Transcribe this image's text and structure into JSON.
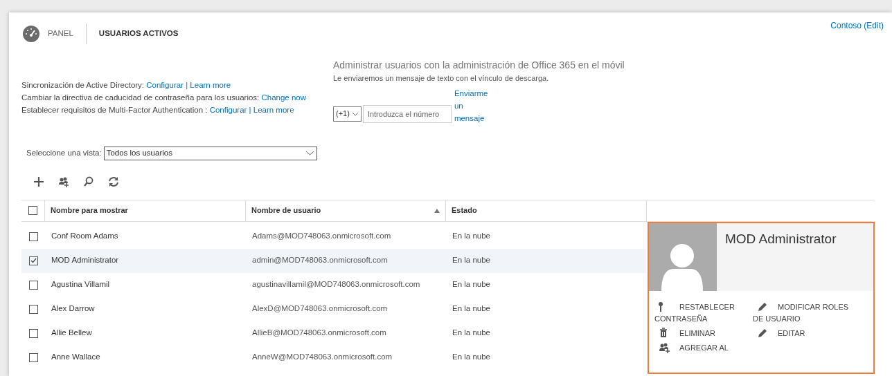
{
  "header": {
    "breadcrumb": [
      {
        "label": "PANEL",
        "selected": false
      },
      {
        "label": "USUARIOS ACTIVOS",
        "selected": true
      }
    ],
    "tenant_link": "Contoso (Edit)"
  },
  "info_lines": [
    {
      "text": "Sincronización de Active Directory: ",
      "links": [
        "Configurar |",
        "Learn more"
      ]
    },
    {
      "text": "Cambiar la directiva de caducidad de contraseña para los usuarios: ",
      "links": [
        "Change now"
      ]
    },
    {
      "text": "Establecer requisitos de Multi-Factor Authentication : ",
      "links": [
        "Configurar",
        "| ",
        "Learn more"
      ]
    }
  ],
  "mobile": {
    "title": "Administrar usuarios con la administración de Office 365 en el móvil",
    "subtitle": "Le enviaremos un mensaje de texto con el vínculo de descarga.",
    "country_code": "(+1)",
    "phone_placeholder": "Introduzca el número",
    "send_link": "Enviarme un mensaje"
  },
  "view_select": {
    "label": "Seleccione una vista:",
    "value": "Todos los usuarios"
  },
  "toolbar": [
    {
      "kind": "add"
    },
    {
      "kind": "add-group"
    },
    {
      "kind": "search"
    },
    {
      "kind": "refresh"
    }
  ],
  "table": {
    "select_all_checked": false,
    "columns": [
      {
        "label": "Nombre para mostrar",
        "sorted": false
      },
      {
        "label": "Nombre de usuario",
        "sorted": true
      },
      {
        "label": "Estado",
        "sorted": false
      }
    ],
    "rows": [
      {
        "name": "Conf Room Adams",
        "user": "Adams@MOD748063.onmicrosoft.com",
        "status": "En la nube",
        "selected": false
      },
      {
        "name": "MOD Administrator",
        "user": "admin@MOD748063.onmicrosoft.com",
        "status": "En la nube",
        "selected": true
      },
      {
        "name": "Agustina Villamil",
        "user": "agustinavillamil@MOD748063.onmicrosoft.com",
        "status": "En la nube",
        "selected": false
      },
      {
        "name": "Alex Darrow",
        "user": "AlexD@MOD748063.onmicrosoft.com",
        "status": "En la nube",
        "selected": false
      },
      {
        "name": "Allie Bellew",
        "user": "AllieB@MOD748063.onmicrosoft.com",
        "status": "En la nube",
        "selected": false
      },
      {
        "name": "Anne Wallace",
        "user": "AnneW@MOD748063.onmicrosoft.com",
        "status": "En la nube",
        "selected": false
      }
    ]
  },
  "details": {
    "name": "MOD Administrator",
    "actions": [
      {
        "kind": "key",
        "label": "RESTABLECER CONTRASEÑA"
      },
      {
        "kind": "pencil",
        "label": "MODIFICAR ROLES DE USUARIO"
      },
      {
        "kind": "trash",
        "label": "ELIMINAR"
      },
      {
        "kind": "pencil",
        "label": "EDITAR"
      },
      {
        "kind": "people",
        "label": "AGREGAR AL"
      }
    ]
  }
}
